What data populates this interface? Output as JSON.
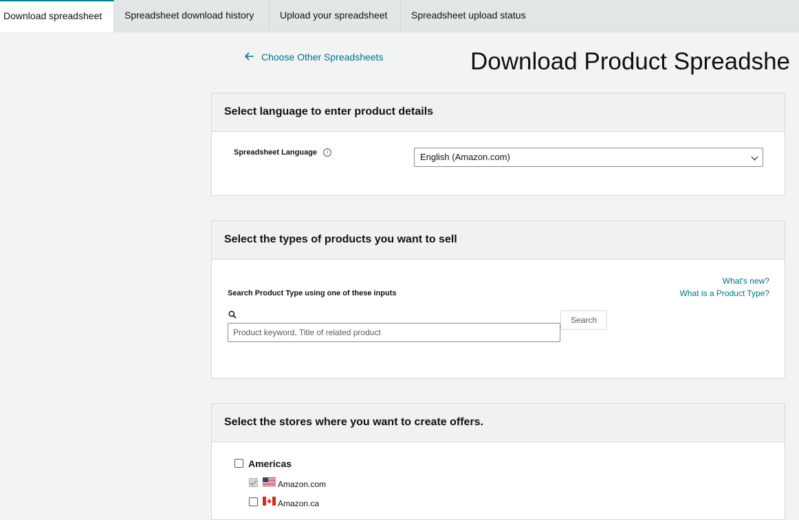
{
  "tabs": [
    {
      "label": "Download spreadsheet",
      "active": true
    },
    {
      "label": "Spreadsheet download history",
      "active": false
    },
    {
      "label": "Upload your spreadsheet",
      "active": false
    },
    {
      "label": "Spreadsheet upload status",
      "active": false
    }
  ],
  "header": {
    "back_link": "Choose Other Spreadsheets",
    "title": "Download Product Spreadshe"
  },
  "language_panel": {
    "heading": "Select language to enter product details",
    "field_label": "Spreadsheet Language",
    "info_icon": "i",
    "selected_value": "English (Amazon.com)"
  },
  "product_panel": {
    "heading": "Select the types of products you want to sell",
    "whats_new": "What's new?",
    "what_is_pt": "What is a Product Type?",
    "search_label": "Search Product Type using one of these inputs",
    "search_placeholder": "Product keyword, Title of related product",
    "search_button": "Search"
  },
  "stores_panel": {
    "heading": "Select the stores where you want to create offers.",
    "group": {
      "label": "Americas",
      "checked": false
    },
    "stores": [
      {
        "label": "Amazon.com",
        "checked": true,
        "disabled": true,
        "flag": "us-flag-icon"
      },
      {
        "label": "Amazon.ca",
        "checked": false,
        "disabled": false,
        "flag": "ca-flag-icon"
      }
    ]
  },
  "colors": {
    "accent": "#008296",
    "link": "#007185",
    "background": "#f2f4f4"
  }
}
